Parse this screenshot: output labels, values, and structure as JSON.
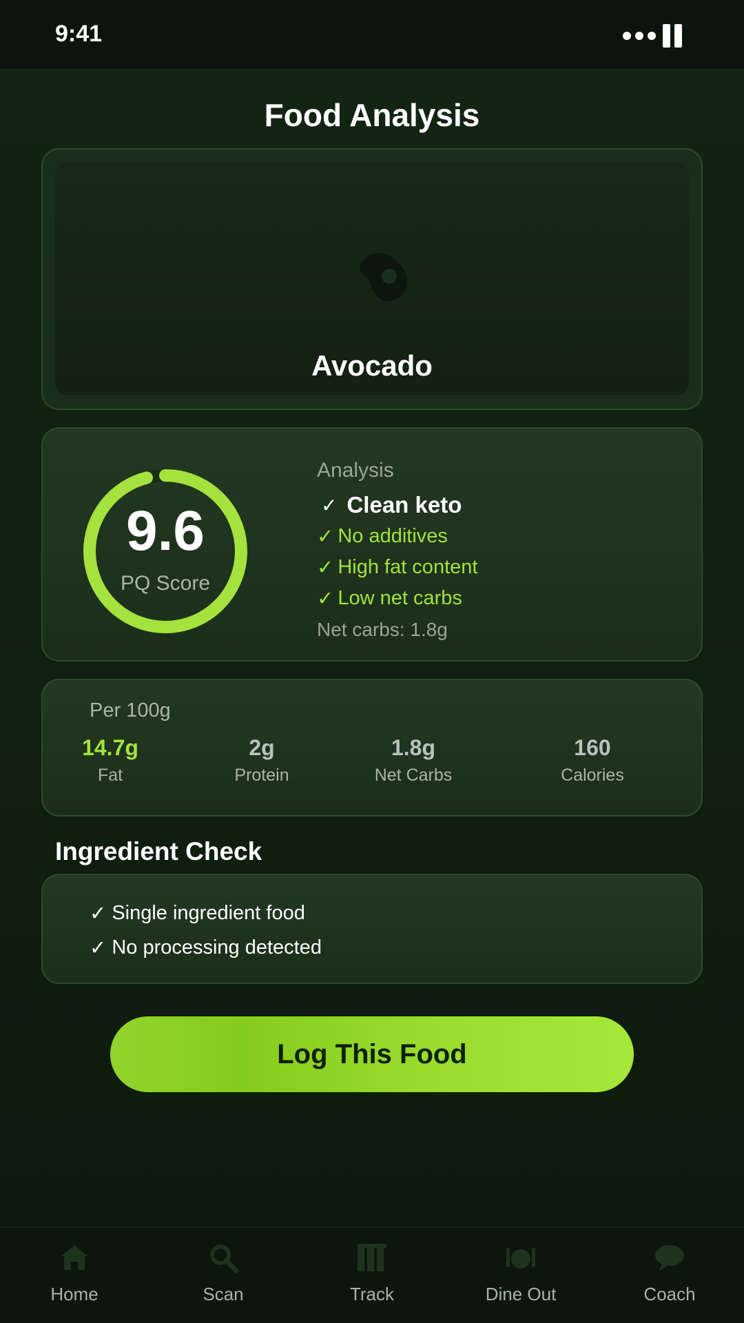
{
  "status_bar": {
    "time": "9:41"
  },
  "header": {
    "title": "Food Analysis"
  },
  "food": {
    "name": "Avocado",
    "image_icon": "meat-icon"
  },
  "score": {
    "value": "9.6",
    "label": "PQ Score",
    "fraction": 0.96,
    "ring_color": "#a4e23d"
  },
  "analysis": {
    "heading": "Analysis",
    "main": "Clean keto",
    "check_symbol": "✓",
    "items": [
      "No additives",
      "High fat content",
      "Low net carbs"
    ],
    "net_carbs": "Net carbs: 1.8g"
  },
  "nutrition": {
    "per_label": "Per 100g",
    "macros": [
      {
        "value": "14.7g",
        "label": "Fat"
      },
      {
        "value": "2g",
        "label": "Protein"
      },
      {
        "value": "1.8g",
        "label": "Net Carbs"
      },
      {
        "value": "160",
        "label": "Calories"
      }
    ]
  },
  "ingredient_check": {
    "title": "Ingredient Check",
    "items": [
      "Single ingredient food",
      "No processing detected"
    ]
  },
  "cta": {
    "label": "Log This Food"
  },
  "nav": {
    "items": [
      {
        "label": "Home",
        "icon": "home-icon"
      },
      {
        "label": "Scan",
        "icon": "search-icon"
      },
      {
        "label": "Track",
        "icon": "chart-icon"
      },
      {
        "label": "Dine Out",
        "icon": "dining-icon"
      },
      {
        "label": "Coach",
        "icon": "chat-icon"
      }
    ]
  },
  "colors": {
    "accent": "#a4e23d",
    "background": "#0f1c0f",
    "card_border": "#2d4a2a"
  }
}
